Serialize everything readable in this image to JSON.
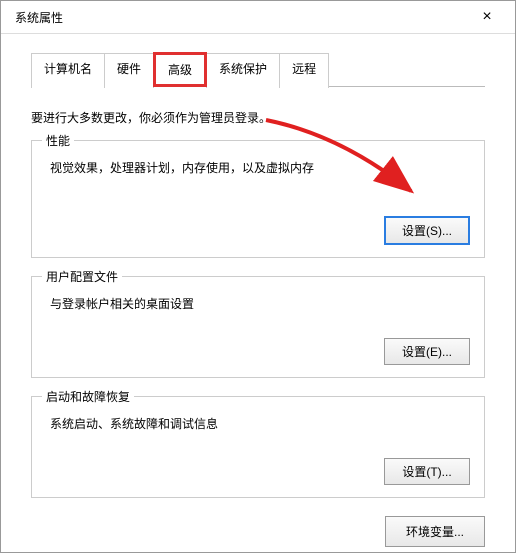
{
  "window": {
    "title": "系统属性",
    "close_icon": "×"
  },
  "tabs": {
    "items": [
      {
        "label": "计算机名"
      },
      {
        "label": "硬件"
      },
      {
        "label": "高级"
      },
      {
        "label": "系统保护"
      },
      {
        "label": "远程"
      }
    ]
  },
  "content": {
    "instruction": "要进行大多数更改，你必须作为管理员登录。",
    "groups": [
      {
        "title": "性能",
        "desc": "视觉效果，处理器计划，内存使用，以及虚拟内存",
        "button": "设置(S)..."
      },
      {
        "title": "用户配置文件",
        "desc": "与登录帐户相关的桌面设置",
        "button": "设置(E)..."
      },
      {
        "title": "启动和故障恢复",
        "desc": "系统启动、系统故障和调试信息",
        "button": "设置(T)..."
      }
    ],
    "env_button": "环境变量..."
  }
}
